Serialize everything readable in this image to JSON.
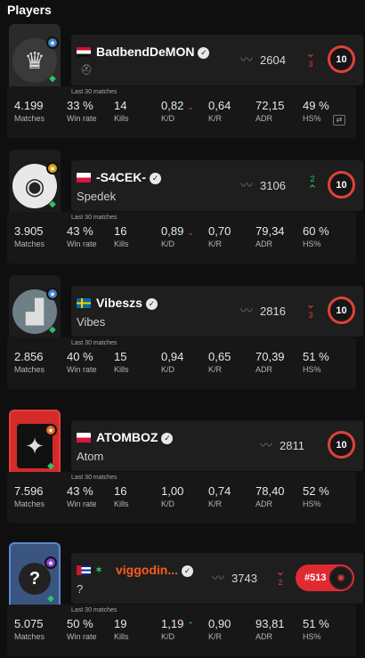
{
  "section": {
    "title": "Players"
  },
  "labels": {
    "last30": "Last 30 matches",
    "matches": "Matches",
    "winrate": "Win rate",
    "kills": "Kills",
    "kd": "K/D",
    "kr": "K/R",
    "adr": "ADR",
    "hs": "HS%"
  },
  "players": [
    {
      "nickname": "BadbendDeMON",
      "subname": "",
      "country": "Egypt",
      "avatar_icon": "helmet-icon",
      "elo": "2604",
      "elo_change": "3",
      "elo_trend": "down",
      "level": "10",
      "stats": {
        "matches": "4.199",
        "winrate": "33 %",
        "kills": "14",
        "kd": "0,82",
        "kd_trend": "down",
        "kr": "0,64",
        "adr": "72,15",
        "hs": "49 %"
      }
    },
    {
      "nickname": "-S4CEK-",
      "subname": "Spedek",
      "country": "Poland",
      "avatar_icon": "logo-icon",
      "elo": "3106",
      "elo_change": "2",
      "elo_trend": "up",
      "level": "10",
      "stats": {
        "matches": "3.905",
        "winrate": "43 %",
        "kills": "16",
        "kd": "0,89",
        "kd_trend": "down",
        "kr": "0,70",
        "adr": "79,34",
        "hs": "60 %"
      }
    },
    {
      "nickname": "Vibeszs",
      "subname": "Vibes",
      "country": "Sweden",
      "avatar_icon": "photo-icon",
      "elo": "2816",
      "elo_change": "3",
      "elo_trend": "down",
      "level": "10",
      "stats": {
        "matches": "2.856",
        "winrate": "40 %",
        "kills": "15",
        "kd": "0,94",
        "kd_trend": "",
        "kr": "0,65",
        "adr": "70,39",
        "hs": "51 %"
      }
    },
    {
      "nickname": "ATOMBOZ",
      "subname": "Atom",
      "country": "Poland",
      "avatar_icon": "atom-logo-icon",
      "elo": "2811",
      "elo_change": "",
      "elo_trend": "",
      "level": "10",
      "stats": {
        "matches": "7.596",
        "winrate": "43 %",
        "kills": "16",
        "kd": "1,00",
        "kd_trend": "",
        "kr": "0,74",
        "adr": "78,40",
        "hs": "52 %"
      }
    },
    {
      "nickname": "viggodin...",
      "subname": "?",
      "country": "Cuba",
      "avatar_icon": "question-icon",
      "elo": "3743",
      "elo_change": "2",
      "elo_trend": "down",
      "level": "",
      "rank": "#513",
      "stats": {
        "matches": "5.075",
        "winrate": "50 %",
        "kills": "19",
        "kd": "1,19",
        "kd_trend": "up",
        "kr": "0,90",
        "adr": "93,81",
        "hs": "51 %"
      }
    }
  ],
  "colors": {
    "accent": "#e0413a",
    "up": "#2fc46a",
    "card": "#1e1e1e",
    "nickname_highlight": "#ff5a1f"
  }
}
